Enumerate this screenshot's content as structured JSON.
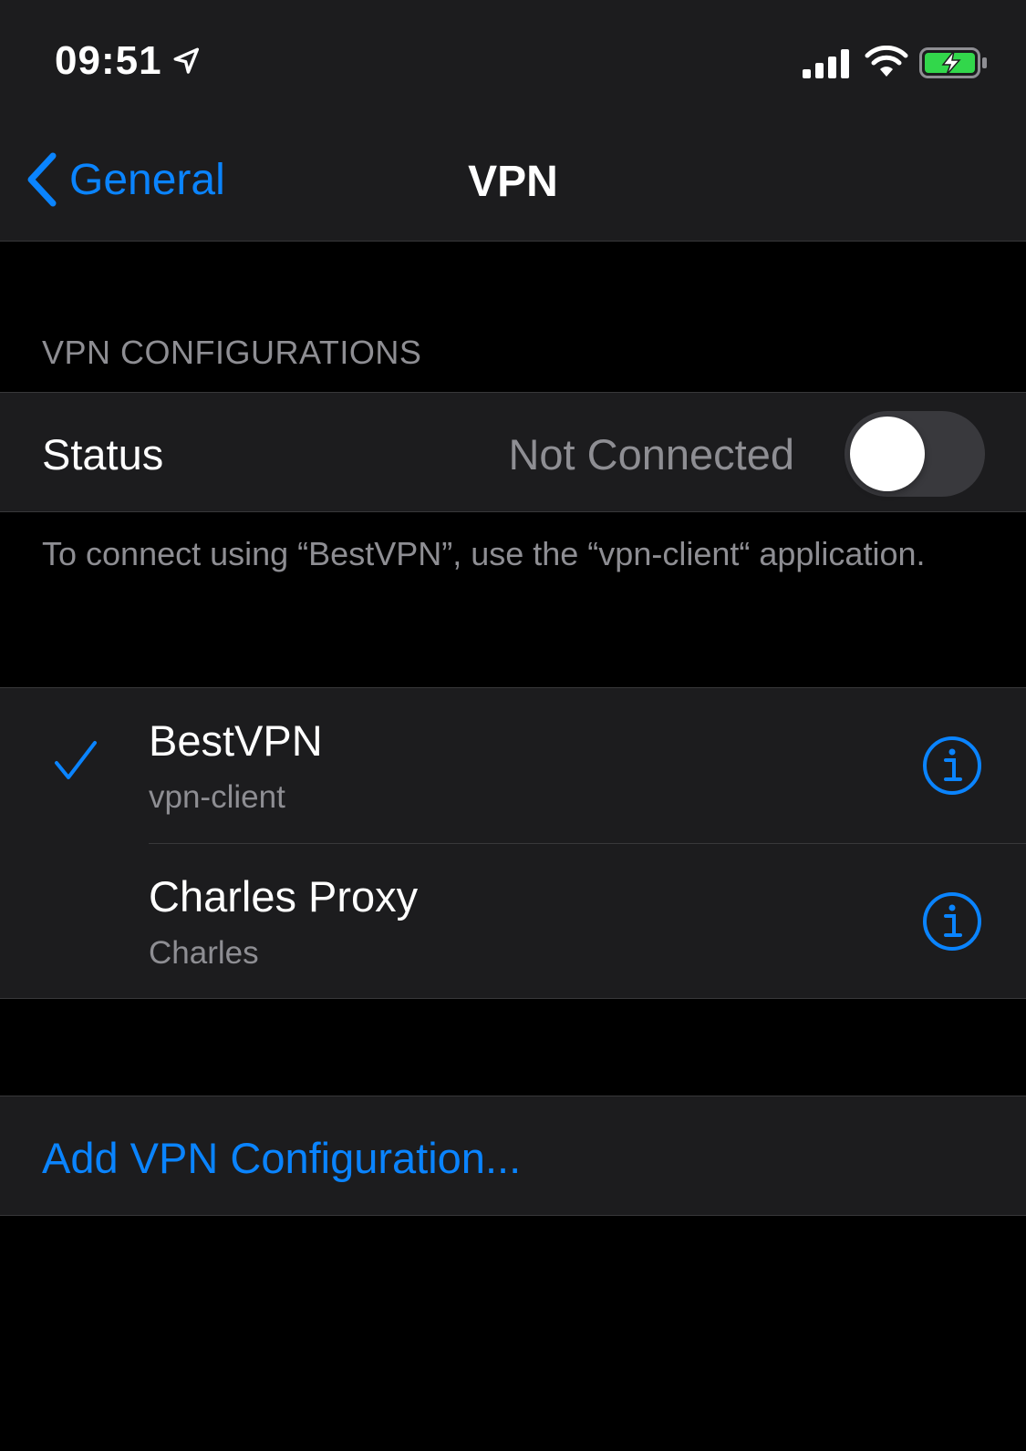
{
  "status_bar": {
    "time": "09:51",
    "icons": [
      "location-arrow-icon",
      "cellular-signal-icon",
      "wifi-icon",
      "battery-charging-icon"
    ]
  },
  "nav": {
    "back_label": "General",
    "title": "VPN"
  },
  "section_header": "VPN CONFIGURATIONS",
  "status": {
    "label": "Status",
    "value": "Not Connected",
    "toggle_on": false
  },
  "footer_note": "To connect using “BestVPN”, use the “vpn-client“ application.",
  "configurations": [
    {
      "name": "BestVPN",
      "subtitle": "vpn-client",
      "selected": true
    },
    {
      "name": "Charles Proxy",
      "subtitle": "Charles",
      "selected": false
    }
  ],
  "add_configuration_label": "Add VPN Configuration...",
  "colors": {
    "accent": "#0a84ff",
    "background": "#000000",
    "cell_background": "#1c1c1e",
    "secondary_text": "#8e8e93",
    "battery_fill": "#32d74b"
  }
}
